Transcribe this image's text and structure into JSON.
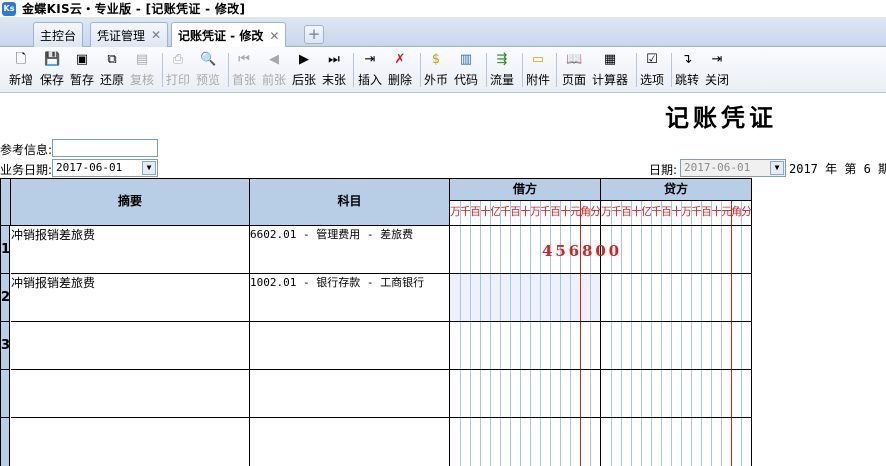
{
  "window": {
    "title": "金蝶KIS云・专业版 - [记账凭证 - 修改]",
    "app_icon": "Ks"
  },
  "tabs": [
    {
      "label": "主控台",
      "closable": false
    },
    {
      "label": "凭证管理",
      "closable": true
    },
    {
      "label": "记账凭证 - 修改",
      "closable": true,
      "active": true
    }
  ],
  "toolbar": [
    {
      "label": "新增",
      "icon": "new-doc-icon",
      "enabled": true
    },
    {
      "label": "保存",
      "icon": "save-icon",
      "enabled": true
    },
    {
      "label": "暂存",
      "icon": "temp-save-icon",
      "enabled": true
    },
    {
      "label": "还原",
      "icon": "restore-icon",
      "enabled": true
    },
    {
      "label": "复核",
      "icon": "review-icon",
      "enabled": false
    },
    {
      "label": "打印",
      "icon": "print-icon",
      "enabled": false
    },
    {
      "label": "预览",
      "icon": "preview-icon",
      "enabled": false
    },
    {
      "label": "首张",
      "icon": "first-icon",
      "enabled": false
    },
    {
      "label": "前张",
      "icon": "prev-icon",
      "enabled": false
    },
    {
      "label": "后张",
      "icon": "next-icon",
      "enabled": true
    },
    {
      "label": "末张",
      "icon": "last-icon",
      "enabled": true
    },
    {
      "label": "插入",
      "icon": "insert-icon",
      "enabled": true
    },
    {
      "label": "删除",
      "icon": "delete-icon",
      "enabled": true
    },
    {
      "label": "外币",
      "icon": "currency-icon",
      "enabled": true
    },
    {
      "label": "代码",
      "icon": "code-icon",
      "enabled": true
    },
    {
      "label": "流量",
      "icon": "flow-icon",
      "enabled": true
    },
    {
      "label": "附件",
      "icon": "attachment-icon",
      "enabled": true
    },
    {
      "label": "页面",
      "icon": "page-icon",
      "enabled": true
    },
    {
      "label": "计算器",
      "icon": "calculator-icon",
      "enabled": true
    },
    {
      "label": "选项",
      "icon": "options-icon",
      "enabled": true
    },
    {
      "label": "跳转",
      "icon": "jump-icon",
      "enabled": true
    },
    {
      "label": "关闭",
      "icon": "close-icon",
      "enabled": true
    }
  ],
  "voucher": {
    "title": "记账凭证",
    "ref_label": "参考信息:",
    "ref_value": "",
    "biz_date_label": "业务日期:",
    "biz_date": "2017-06-01",
    "date_label": "日期:",
    "date": "2017-06-01",
    "period_text": "2017 年 第 6 期"
  },
  "grid": {
    "headers": {
      "summary": "摘要",
      "account": "科目",
      "debit": "借方",
      "credit": "贷方"
    },
    "units": [
      "万",
      "千",
      "百",
      "十",
      "亿",
      "千",
      "百",
      "十",
      "万",
      "千",
      "百",
      "十",
      "元",
      "角",
      "分"
    ],
    "rows": [
      {
        "no": "1",
        "summary": "冲销报销差旅费",
        "account": "6602.01 - 管理费用 - 差旅费",
        "debit": "456800",
        "credit": ""
      },
      {
        "no": "2",
        "summary": "冲销报销差旅费",
        "account": "1002.01 - 银行存款 - 工商银行",
        "debit": "",
        "credit": ""
      },
      {
        "no": "3",
        "summary": "",
        "account": "",
        "debit": "",
        "credit": ""
      },
      {
        "no": "",
        "summary": "",
        "account": "",
        "debit": "",
        "credit": ""
      },
      {
        "no": "",
        "summary": "",
        "account": "",
        "debit": "",
        "credit": ""
      }
    ]
  },
  "colors": {
    "header_bg": "#b8cde6",
    "amount_red": "#d32424",
    "grid_line": "#a8c8d8"
  }
}
